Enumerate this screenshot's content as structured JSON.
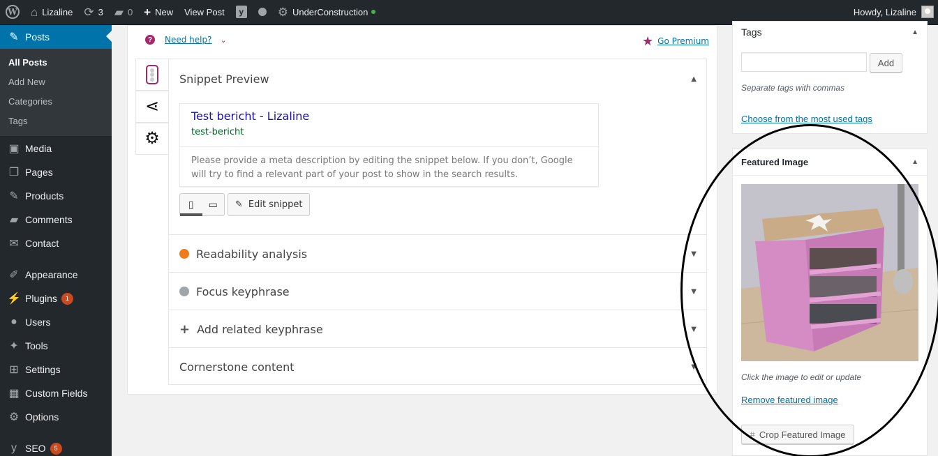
{
  "admin_bar": {
    "site_name": "Lizaline",
    "updates_count": "3",
    "comments_count": "0",
    "new_label": "New",
    "view_post_label": "View Post",
    "under_construction_label": "UnderConstruction",
    "howdy": "Howdy, Lizaline"
  },
  "sidebar": {
    "posts": "Posts",
    "submenu": [
      "All Posts",
      "Add New",
      "Categories",
      "Tags"
    ],
    "items": [
      "Media",
      "Pages",
      "Products",
      "Comments",
      "Contact"
    ],
    "items2": [
      "Appearance",
      "Plugins",
      "Users",
      "Tools",
      "Settings",
      "Custom Fields",
      "Options"
    ],
    "plugins_badge": "1",
    "seo": "SEO",
    "seo_badge": "5"
  },
  "yoast": {
    "need_help": "Need help?",
    "go_premium": "Go Premium",
    "snippet_preview": "Snippet Preview",
    "snippet_title": "Test bericht - Lizaline",
    "snippet_url": "test-bericht",
    "snippet_desc": "Please provide a meta description by editing the snippet below. If you don’t, Google will try to find a relevant part of your post to show in the search results.",
    "edit_snippet": "Edit snippet",
    "readability": "Readability analysis",
    "focus_keyphrase": "Focus keyphrase",
    "related_keyphrase": "Add related keyphrase",
    "cornerstone": "Cornerstone content"
  },
  "tags_box": {
    "title": "Tags",
    "add_button": "Add",
    "hint": "Separate tags with commas",
    "most_used_link": "Choose from the most used tags"
  },
  "featured_image": {
    "title": "Featured Image",
    "hint": "Click the image to edit or update",
    "remove_link": "Remove featured image",
    "crop_button": "Crop Featured Image"
  },
  "colors": {
    "admin_bar": "#23282d",
    "menu_current": "#0073aa",
    "yoast_purple": "#a4286a",
    "link": "#0073aa",
    "badge": "#ca4a1f",
    "readability_dot": "#ee7c1b"
  },
  "icons": {
    "logo": "wordpress-icon",
    "updates": "refresh-icon",
    "comments": "comment-bubble-icon",
    "new": "plus-icon",
    "yoast": "yoast-icon",
    "help": "question-icon",
    "premium": "star-icon",
    "share": "share-icon",
    "settings": "gear-icon"
  }
}
